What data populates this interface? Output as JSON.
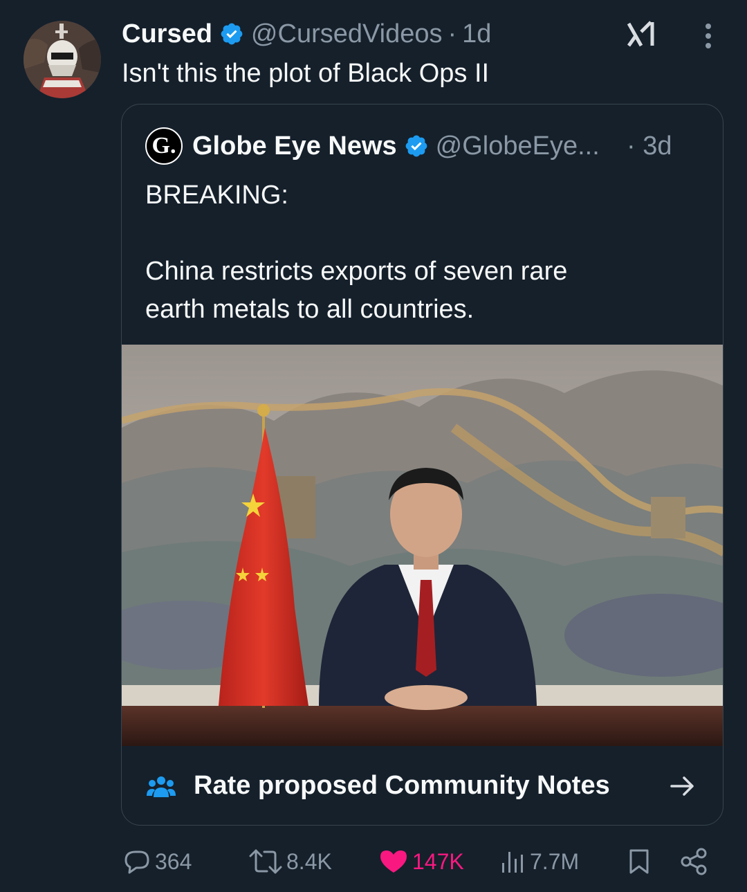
{
  "tweet": {
    "author_name": "Cursed",
    "handle": "@CursedVideos",
    "separator": "·",
    "time": "1d",
    "text": "Isn't this the plot of Black Ops II"
  },
  "quote": {
    "avatar_letter": "G.",
    "author_name": "Globe Eye News",
    "handle": "@GlobeEye...",
    "time": "· 3d",
    "text": "BREAKING:\n\nChina restricts exports of seven rare\nearth metals to all countries.",
    "community_notes_label": "Rate proposed Community Notes"
  },
  "actions": {
    "replies": "364",
    "reposts": "8.4K",
    "likes": "147K",
    "views": "7.7M"
  },
  "colors": {
    "background": "#15202b",
    "verified": "#1d9bf0",
    "like": "#f91880",
    "muted": "#8b98a5"
  }
}
